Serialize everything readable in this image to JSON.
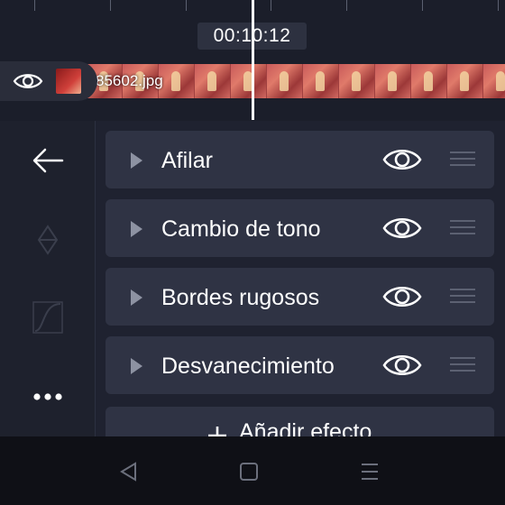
{
  "timeline": {
    "timecode": "00:10:12",
    "clip_name": "85602.jpg"
  },
  "effects": [
    {
      "label": "Afilar",
      "icon": "eye-icon"
    },
    {
      "label": "Cambio de tono",
      "icon": "eye-icon"
    },
    {
      "label": "Bordes rugosos",
      "icon": "eye-icon"
    },
    {
      "label": "Desvanecimiento",
      "icon": "eye-icon"
    }
  ],
  "add_effect": {
    "label": "Añadir efecto",
    "icon": "plus-icon"
  },
  "sidebar": {
    "icons": [
      "back-arrow-icon",
      "keyframe-diamond-icon",
      "curve-icon",
      "more-dots-icon"
    ]
  },
  "navbar": {
    "icons": [
      "back-triangle-icon",
      "home-square-icon",
      "recents-menu-icon"
    ]
  },
  "colors": {
    "background": "#1f2230",
    "row": "#2f3344",
    "text": "#ffffff",
    "muted": "#8d92a2",
    "clip": "#b04848"
  }
}
